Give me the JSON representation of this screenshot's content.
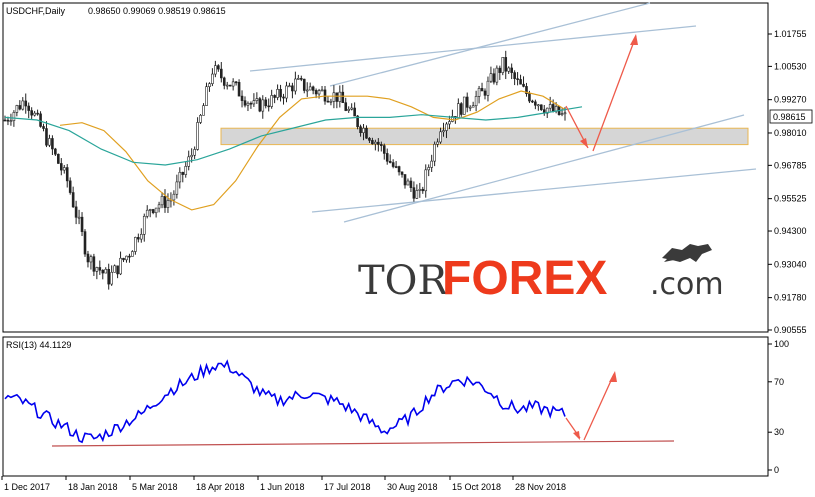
{
  "header": {
    "symbol": "USDCHF,Daily",
    "ohlc": "0.98650 0.99069 0.98519 0.98615"
  },
  "price_axis": {
    "ticks": [
      "1.01755",
      "1.00530",
      "0.99270",
      "0.98010",
      "0.96785",
      "0.95525",
      "0.94300",
      "0.93040",
      "0.91780",
      "0.90555"
    ],
    "current_price": "0.98615"
  },
  "rsi_panel": {
    "label": "RSI(13) 44.1129",
    "ticks": [
      "100",
      "70",
      "30",
      "0"
    ]
  },
  "time_axis": {
    "labels": [
      "1 Dec 2017",
      "18 Jan 2018",
      "5 Mar 2018",
      "18 Apr 2018",
      "1 Jun 2018",
      "17 Jul 2018",
      "30 Aug 2018",
      "15 Oct 2018",
      "28 Nov 2018"
    ]
  },
  "watermark": {
    "part1": "TOR",
    "part2": "FOREX",
    "part3": ".com",
    "icon": "bull-bear-icon"
  },
  "colors": {
    "candle": "#222222",
    "ma_fast": "#e0a020",
    "ma_slow": "#2aa59a",
    "trendline": "#a9c0d6",
    "zone": "#d2d2d2",
    "zone_border": "#e8b040",
    "arrow": "#ee5a4a",
    "rsi_line": "#0000ee",
    "rsi_support": "#c05050",
    "logo_accent": "#ee3a1c"
  },
  "chart_data": [
    {
      "type": "candlestick",
      "title": "USDCHF,Daily",
      "x": [
        "1 Dec 2017",
        "18 Jan 2018",
        "5 Mar 2018",
        "18 Apr 2018",
        "1 Jun 2018",
        "17 Jul 2018",
        "30 Aug 2018",
        "15 Oct 2018",
        "28 Nov 2018"
      ],
      "ylim": [
        0.9038,
        1.0325
      ],
      "approx_close": [
        0.985,
        0.993,
        0.978,
        0.962,
        0.933,
        0.925,
        0.935,
        0.952,
        0.955,
        0.972,
        1.004,
        0.998,
        0.99,
        0.993,
        0.999,
        0.996,
        0.994,
        0.984,
        0.976,
        0.964,
        0.956,
        0.983,
        0.99,
        0.995,
        1.006,
        0.996,
        0.99,
        0.986
      ],
      "series": [
        {
          "name": "",
          "values": [
            0.983,
            0.984,
            0.981,
            0.973,
            0.962,
            0.955,
            0.951,
            0.953,
            0.962,
            0.975,
            0.986,
            0.993,
            0.994,
            0.994,
            0.994,
            0.993,
            0.99,
            0.986,
            0.985,
            0.988,
            0.993,
            0.996,
            0.994,
            0.989
          ]
        },
        {
          "name": "",
          "values": [
            0.986,
            0.985,
            0.981,
            0.974,
            0.969,
            0.968,
            0.97,
            0.974,
            0.979,
            0.982,
            0.985,
            0.986,
            0.986,
            0.987,
            0.986,
            0.985,
            0.986,
            0.988,
            0.99
          ]
        }
      ],
      "zone": [
        0.9757,
        0.9819
      ],
      "annotations": [
        "projected dip",
        "projected rise"
      ]
    },
    {
      "type": "line",
      "title": "RSI(13) 44.1129",
      "ylim": [
        0,
        100
      ],
      "yticks": [
        100,
        70,
        30,
        0
      ],
      "values": [
        58,
        55,
        48,
        40,
        34,
        26,
        25,
        31,
        38,
        44,
        55,
        64,
        70,
        78,
        84,
        81,
        70,
        60,
        55,
        58,
        61,
        57,
        54,
        47,
        39,
        31,
        36,
        44,
        58,
        66,
        72,
        70,
        63,
        52,
        48,
        50,
        47,
        44
      ],
      "support": [
        20,
        22
      ]
    }
  ]
}
